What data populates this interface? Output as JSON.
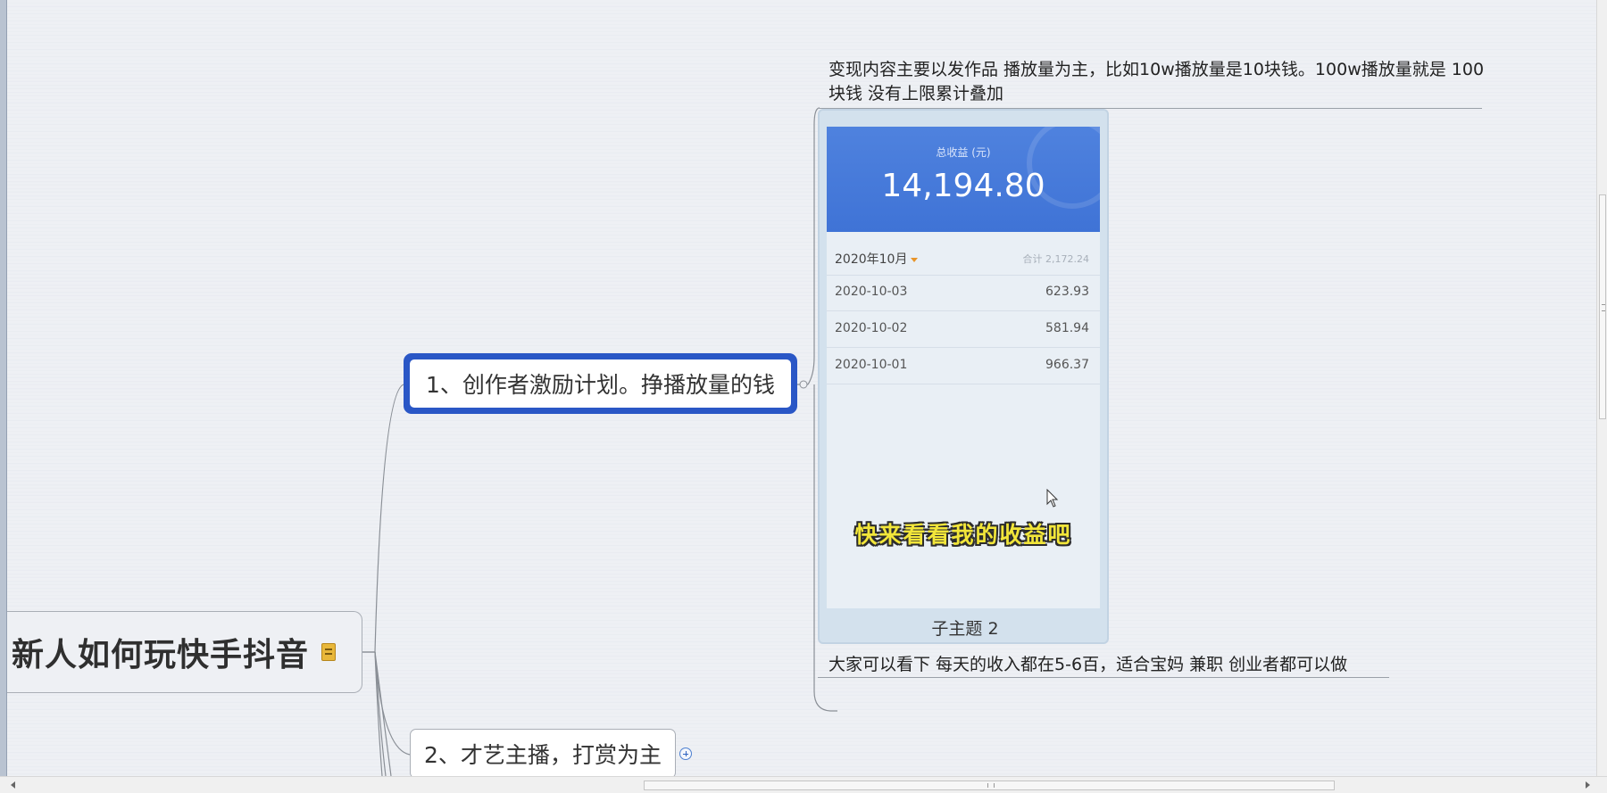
{
  "mindmap": {
    "root": {
      "label": "新人如何玩快手抖音",
      "icon": "note-icon"
    },
    "topics": [
      {
        "label": "1、创作者激励计划。挣播放量的钱",
        "state": "selected"
      },
      {
        "label": "2、才艺主播，打赏为主",
        "state": "collapsed",
        "expand_icon": "plus-circle-icon"
      }
    ],
    "subtopic": {
      "note_top": "变现内容主要以发作品 播放量为主，比如10w播放量是10块钱。100w播放量就是 100块钱  没有上限累计叠加",
      "image_caption": "子主题 2",
      "note_bottom": "大家可以看下  每天的收入都在5-6百，适合宝妈 兼职 创业者都可以做"
    }
  },
  "earnings_card": {
    "total_label": "总收益 (元)",
    "total_value": "14,194.80",
    "month": "2020年10月",
    "month_total": "合计 2,172.24",
    "records": [
      {
        "date": "2020-10-03",
        "amount": "623.93"
      },
      {
        "date": "2020-10-02",
        "amount": "581.94"
      },
      {
        "date": "2020-10-01",
        "amount": "966.37"
      }
    ],
    "overlay_text": "快来看看我的收益吧",
    "header_color": "#4a7fdc",
    "overlay_color": "#f2e63a"
  },
  "colors": {
    "selection_border": "#2a57c6",
    "canvas": "#eef0f4",
    "connector": "#8a8f96"
  }
}
